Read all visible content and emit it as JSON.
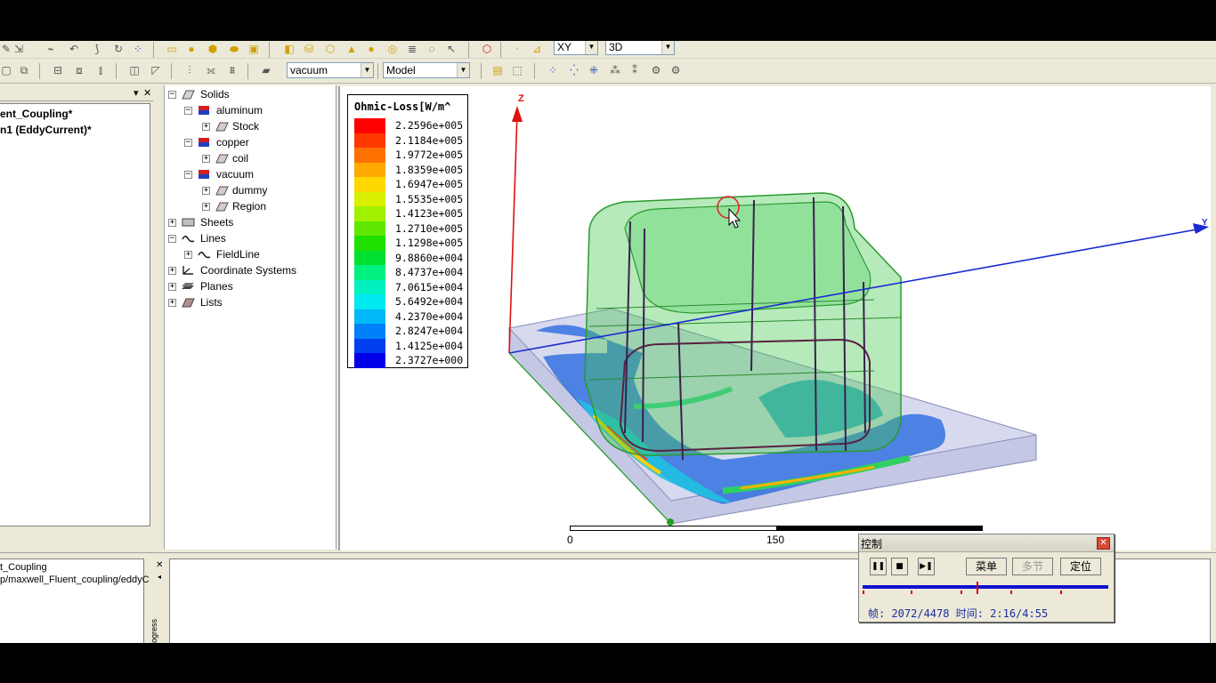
{
  "toolbar": {
    "plane_select": "XY",
    "view_select": "3D",
    "material_select": "vacuum",
    "mode_select": "Model"
  },
  "left_panel": {
    "lines": [
      "ent_Coupling*",
      "n1 (EddyCurrent)*"
    ]
  },
  "history_tree": {
    "nodes": [
      {
        "label": "Solids",
        "expander": "−"
      },
      {
        "label": "aluminum",
        "expander": "−"
      },
      {
        "label": "Stock",
        "expander": "+"
      },
      {
        "label": "copper",
        "expander": "−"
      },
      {
        "label": "coil",
        "expander": "+"
      },
      {
        "label": "vacuum",
        "expander": "−"
      },
      {
        "label": "dummy",
        "expander": "+"
      },
      {
        "label": "Region",
        "expander": "+"
      },
      {
        "label": "Sheets",
        "expander": "+"
      },
      {
        "label": "Lines",
        "expander": "−"
      },
      {
        "label": "FieldLine",
        "expander": "+"
      },
      {
        "label": "Coordinate Systems",
        "expander": "+"
      },
      {
        "label": "Planes",
        "expander": "+"
      },
      {
        "label": "Lists",
        "expander": "+"
      }
    ]
  },
  "legend": {
    "title": "Ohmic-Loss[W/m^",
    "entries": [
      {
        "value": "2.2596e+005",
        "color": "#ff0000"
      },
      {
        "value": "2.1184e+005",
        "color": "#ff3800"
      },
      {
        "value": "1.9772e+005",
        "color": "#ff7000"
      },
      {
        "value": "1.8359e+005",
        "color": "#ffa800"
      },
      {
        "value": "1.6947e+005",
        "color": "#ffd800"
      },
      {
        "value": "1.5535e+005",
        "color": "#d8f000"
      },
      {
        "value": "1.4123e+005",
        "color": "#a0f000"
      },
      {
        "value": "1.2710e+005",
        "color": "#60e800"
      },
      {
        "value": "1.1298e+005",
        "color": "#20e000"
      },
      {
        "value": "9.8860e+004",
        "color": "#00e030"
      },
      {
        "value": "8.4737e+004",
        "color": "#00f080"
      },
      {
        "value": "7.0615e+004",
        "color": "#00f0c0"
      },
      {
        "value": "5.6492e+004",
        "color": "#00e8f0"
      },
      {
        "value": "4.2370e+004",
        "color": "#00b8f8"
      },
      {
        "value": "2.8247e+004",
        "color": "#0080f8"
      },
      {
        "value": "1.4125e+004",
        "color": "#0040f0"
      },
      {
        "value": "2.3727e+000",
        "color": "#0000e8"
      }
    ]
  },
  "viewport": {
    "axis_z": "Z",
    "axis_y": "Y",
    "scale_labels": [
      "0",
      "150"
    ]
  },
  "bottom": {
    "project_lines": [
      "t_Coupling",
      "p/maxwell_Fluent_coupling/eddyC"
    ],
    "progress_label": "rogress"
  },
  "control_window": {
    "title": "控制",
    "menu_button": "菜单",
    "chapter_button": "多节",
    "locate_button": "定位",
    "info": "帧: 2072/4478 时间: 2:16/4:55",
    "progress_fraction": 0.463
  }
}
